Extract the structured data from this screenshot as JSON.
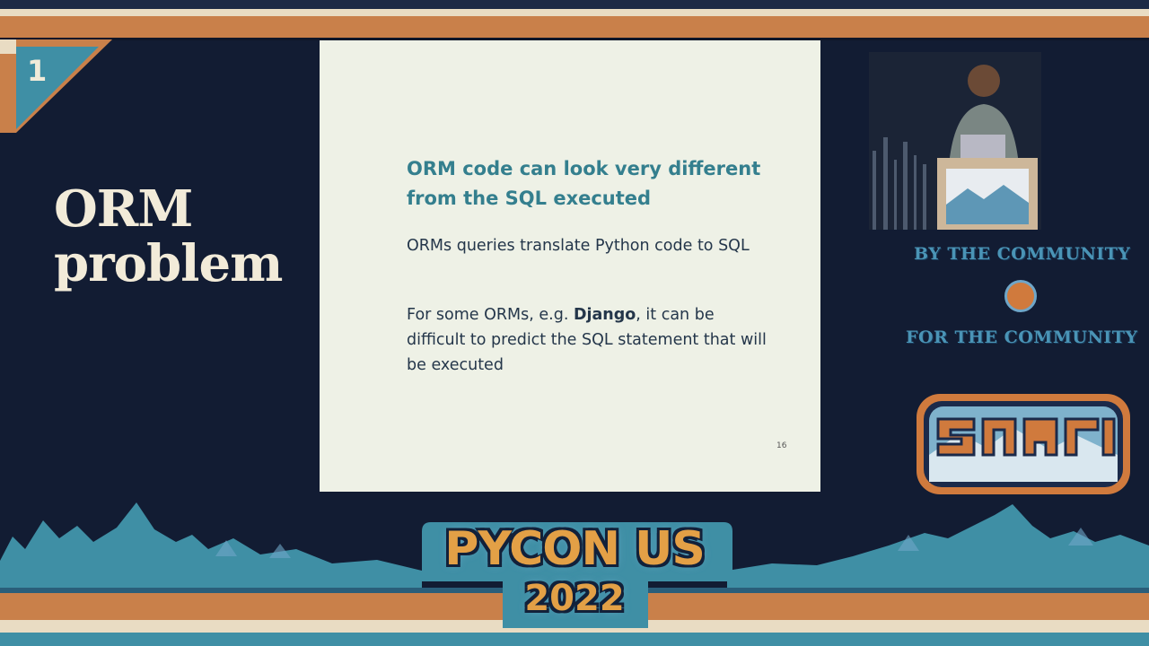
{
  "room": {
    "number": "1"
  },
  "talk": {
    "title_line1": "ORM",
    "title_line2": "problem"
  },
  "slide": {
    "heading": "ORM code can look very different from the SQL executed",
    "paragraph1": "ORMs queries translate Python code to SQL",
    "paragraph2_before": "For some ORMs, e.g. ",
    "paragraph2_bold": "Django",
    "paragraph2_after": ", it can be difficult to predict the SQL statement that will be executed",
    "page_number": "16"
  },
  "sidebar": {
    "tagline_top": "BY THE COMMUNITY",
    "tagline_bottom": "FOR THE COMMUNITY"
  },
  "conference": {
    "name": "PYCON US",
    "year": "2022"
  },
  "colors": {
    "background": "#121c33",
    "accent_orange": "#c9804a",
    "accent_teal": "#3f8fa5",
    "cream": "#e9dcc3",
    "slide_heading": "#347f8e"
  }
}
